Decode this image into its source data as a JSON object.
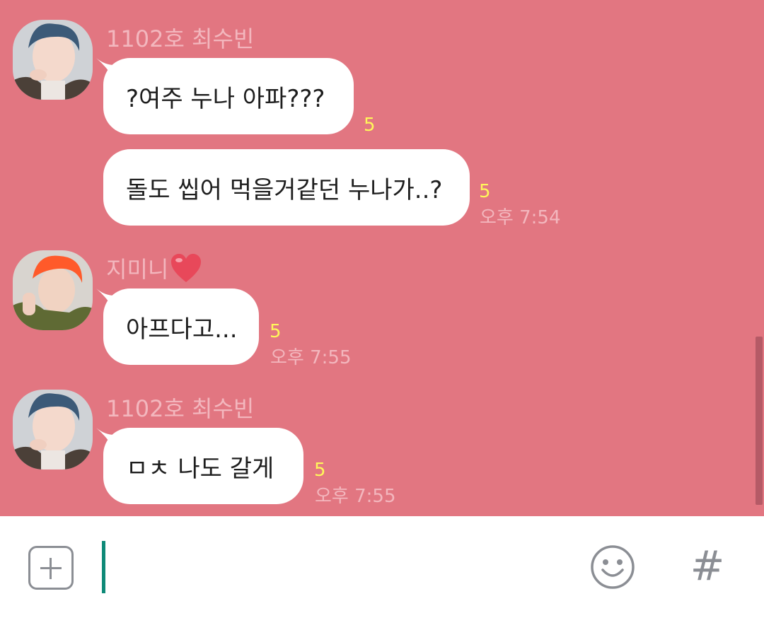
{
  "messages": [
    {
      "sender": "1102호 최수빈",
      "avatar": "avatar-soobin",
      "bubbles": [
        {
          "text": "?여주 누나 아파???",
          "read_count": "5",
          "time": ""
        },
        {
          "text": "돌도 씹어 먹을거같던 누나가..?",
          "read_count": "5",
          "time": "오후 7:54"
        }
      ]
    },
    {
      "sender": "지미니",
      "avatar": "avatar-jimin",
      "bubbles": [
        {
          "text": "아프다고...",
          "read_count": "5",
          "time": "오후 7:55"
        }
      ]
    },
    {
      "sender": "1102호 최수빈",
      "avatar": "avatar-soobin",
      "bubbles": [
        {
          "text": "ㅁㅊ 나도 갈게",
          "read_count": "5",
          "time": "오후 7:55"
        }
      ]
    }
  ],
  "colors": {
    "chat_background": "#e27681",
    "bubble": "#ffffff",
    "read_count": "#fff75a",
    "meta_text": "#f3b7be",
    "cursor": "#0e8a78",
    "icon_gray": "#8b8e94"
  },
  "input_bar": {
    "attach_icon": "plus-box-icon",
    "emoji_icon": "smiley-icon",
    "hashtag_label": "#",
    "input_value": ""
  }
}
